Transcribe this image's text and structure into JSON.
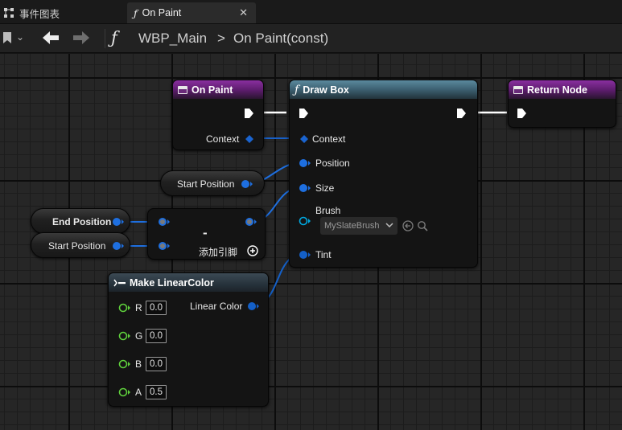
{
  "tabs": [
    {
      "label": "事件图表",
      "icon": "event-graph-icon",
      "active": false
    },
    {
      "label": "On Paint",
      "icon": "function-icon",
      "active": true
    }
  ],
  "breadcrumb": {
    "icon": "function-icon",
    "blueprint": "WBP_Main",
    "separator": ">",
    "function": "On Paint(const)"
  },
  "nodes": {
    "on_paint": {
      "title": "On Paint",
      "icon": "event-icon",
      "header_color": "#6a2280",
      "context_label": "Context"
    },
    "draw_box": {
      "title": "Draw Box",
      "icon": "function-icon",
      "header_color": "#4a7080",
      "pins": {
        "context": "Context",
        "position": "Position",
        "size": "Size",
        "brush": "Brush",
        "tint": "Tint"
      },
      "brush_value": "MySlateBrush"
    },
    "return_node": {
      "title": "Return Node",
      "icon": "event-icon",
      "header_color": "#6a2280"
    },
    "start_position_var_1": {
      "label": "Start Position"
    },
    "end_position_var": {
      "label": "End Position"
    },
    "start_position_var_2": {
      "label": "Start Position"
    },
    "subtract": {
      "symbol": "-",
      "add_pin_label": "添加引脚"
    },
    "make_linear_color": {
      "title": "Make LinearColor",
      "icon": "make-struct-icon",
      "output_label": "Linear Color",
      "inputs": [
        {
          "name": "R",
          "value": "0.0"
        },
        {
          "name": "G",
          "value": "0.0"
        },
        {
          "name": "B",
          "value": "0.0"
        },
        {
          "name": "A",
          "value": "0.5"
        }
      ]
    }
  },
  "colors": {
    "exec_pin": "#ffffff",
    "vector_pin": "#1e6fe0",
    "struct_pin": "#1460c8",
    "float_pin": "#5fd03c",
    "brush_pin": "#00a8e0",
    "graph_bg": "#262626"
  }
}
